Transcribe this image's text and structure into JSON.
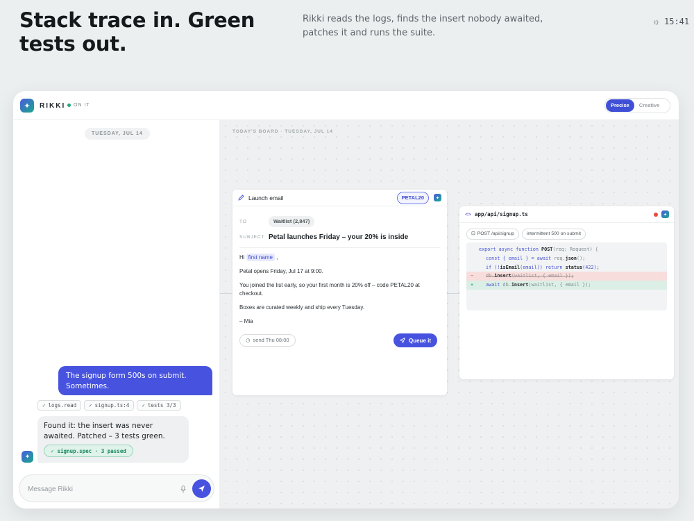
{
  "hero": {
    "title": "Stack trace in. Green tests out.",
    "subtitle": "Rikki reads the logs, finds the insert nobody awaited, patches it and runs the suite.",
    "time": "15:41"
  },
  "app": {
    "brand": "RIKKI",
    "status": "ON IT",
    "modes": [
      "Precise",
      "Creative"
    ],
    "active_mode": "Precise"
  },
  "chat": {
    "date": "TUESDAY, JUL 14",
    "user_message": "The signup form 500s on submit. Sometimes.",
    "tools": [
      "logs.read",
      "signup.ts:4",
      "tests 3/3"
    ],
    "bot_message": "Found it: the insert was never awaited. Patched – 3 tests green.",
    "result_pill": "signup.spec · 3 passed",
    "composer_placeholder": "Message Rikki"
  },
  "board": {
    "label": "TODAY'S BOARD · TUESDAY, JUL 14",
    "email_card": {
      "title": "Launch email",
      "coupon": "PETAL20",
      "to_label": "TO",
      "to_value": "Waitlist (2,847)",
      "subject_label": "SUBJECT",
      "subject": "Petal launches Friday – your 20% is inside",
      "greeting": "Hi",
      "merge_tag": "first name",
      "greeting_end": ",",
      "line1": "Petal opens Friday, Jul 17 at 9:00.",
      "line2": "You joined the list early, so your first month is 20% off – code PETAL20 at checkout.",
      "line3": "Boxes are curated weekly and ship every Tuesday.",
      "signoff": "– Mia",
      "schedule": "send Thu 08:00",
      "queue_button": "Queue it"
    },
    "code_card": {
      "file": "app/api/signup.ts",
      "route": "POST /api/signup",
      "issue": "intermittent 500 on submit",
      "lines": {
        "l1a": "export async function ",
        "l1b": "POST",
        "l1c": "(req: Request) {",
        "l2a": "const { email } = ",
        "l2b": "await",
        "l2c": " req.",
        "l2d": "json",
        "l2e": "();",
        "l3a": "if (!",
        "l3b": "isEmail",
        "l3c": "(email)) return ",
        "l3d": "status",
        "l3e": "(422);",
        "del_mark": "−",
        "del_a": "db.",
        "del_b": "insert",
        "del_c": "(waitlist, { email });",
        "add_mark": "+",
        "add_a": "await",
        "add_b": " db.",
        "add_c": "insert",
        "add_d": "(waitlist, { email });"
      }
    }
  },
  "colors": {
    "accent": "#4753df",
    "success": "#1fab7b",
    "danger": "#e84a3c"
  }
}
